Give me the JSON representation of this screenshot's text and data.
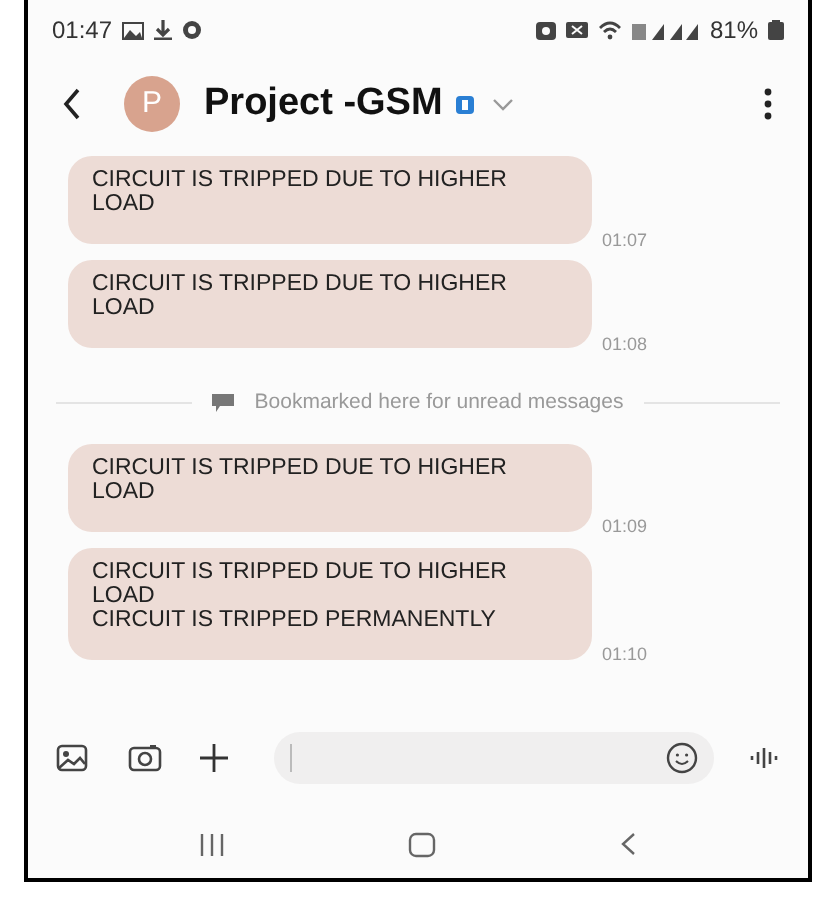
{
  "status_bar": {
    "time": "01:47",
    "battery": "81%"
  },
  "header": {
    "avatar_letter": "P",
    "title": "Project -GSM"
  },
  "messages": [
    {
      "kind": "message",
      "text": "CIRCUIT IS TRIPPED DUE TO HIGHER LOAD",
      "time": "01:07"
    },
    {
      "kind": "message",
      "text": "CIRCUIT IS TRIPPED DUE TO HIGHER LOAD",
      "time": "01:08"
    },
    {
      "kind": "divider",
      "text": "Bookmarked here for unread messages"
    },
    {
      "kind": "message",
      "text": "CIRCUIT IS TRIPPED DUE TO HIGHER LOAD",
      "time": "01:09"
    },
    {
      "kind": "message",
      "text": "CIRCUIT IS TRIPPED DUE TO HIGHER LOAD\nCIRCUIT IS TRIPPED PERMANENTLY",
      "time": "01:10"
    }
  ]
}
